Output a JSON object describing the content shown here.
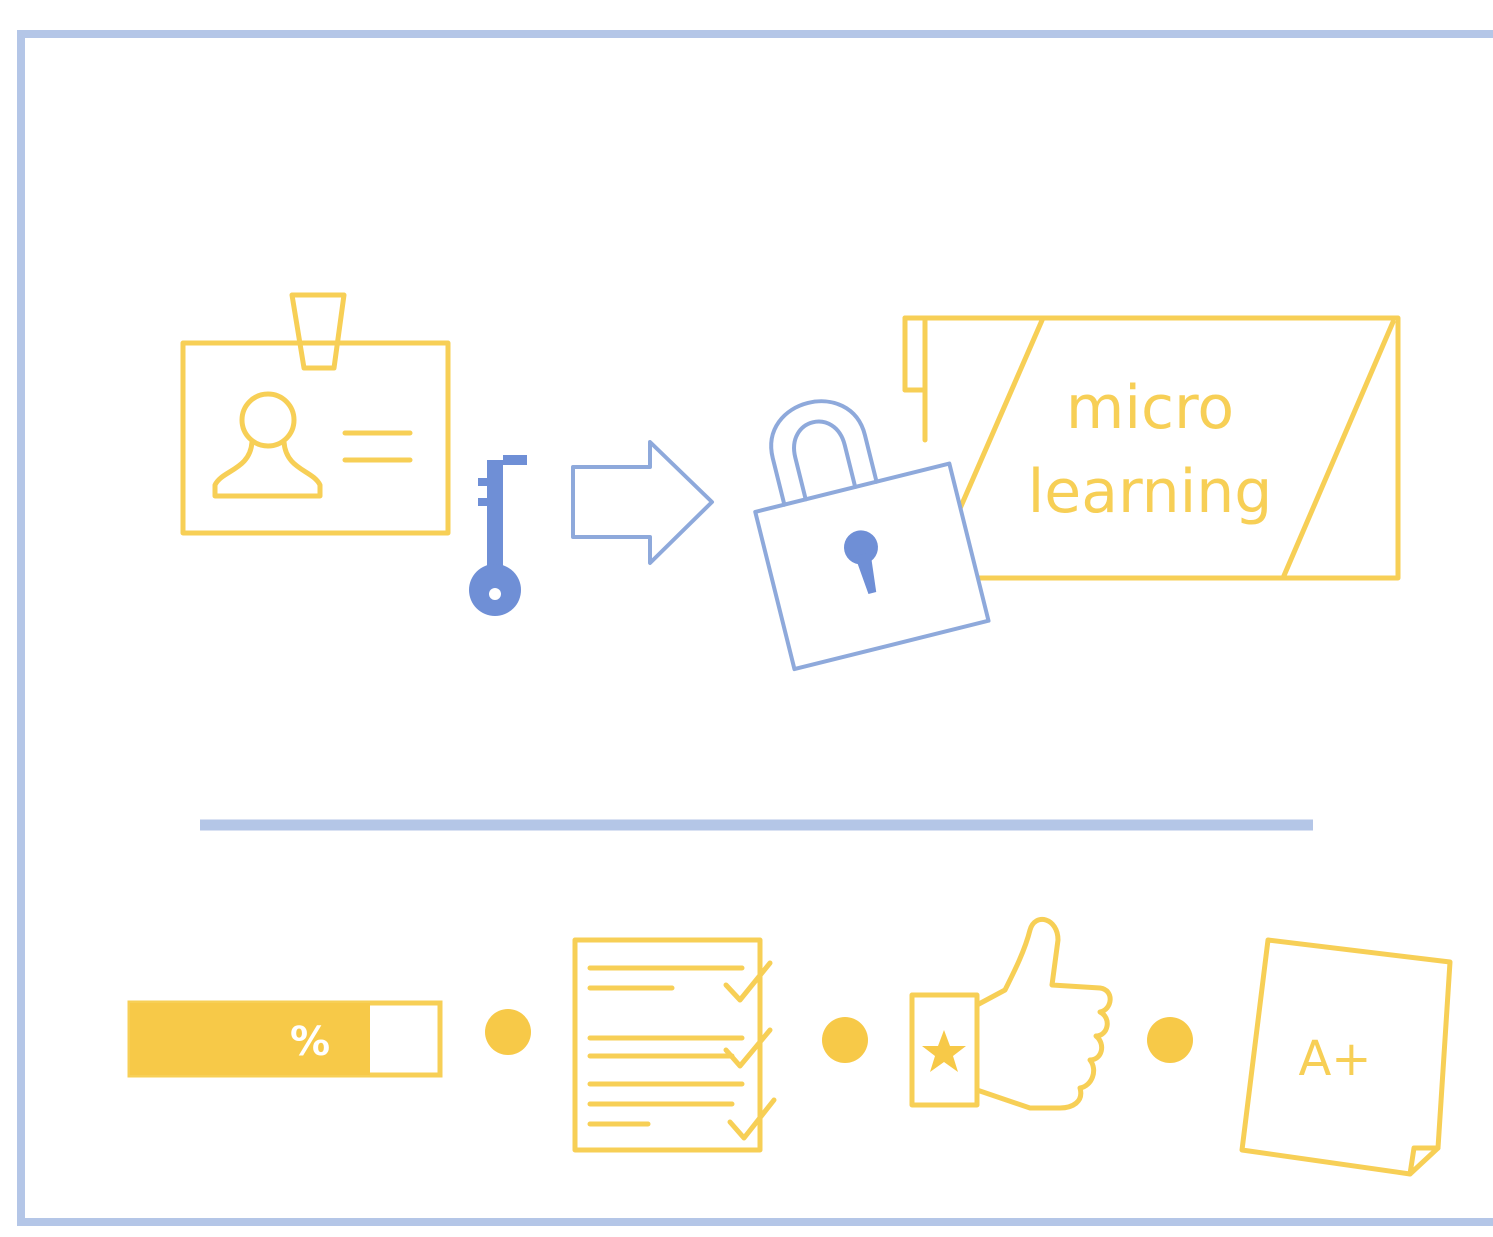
{
  "panel": {
    "microlearning_line1": "micro",
    "microlearning_line2": "learning"
  },
  "progress": {
    "symbol": "%"
  },
  "grade_card": {
    "grade": "A+"
  },
  "colors": {
    "yellow": "#f7cf56",
    "yellow_fill": "#f7c948",
    "blue": "#8ea9db",
    "blue_dark": "#6f8fd6",
    "frame": "#b4c6e7"
  },
  "icons": [
    "id-badge-icon",
    "key-icon",
    "arrow-right-icon",
    "padlock-open-icon",
    "microlearning-panel-icon",
    "progress-bar-icon",
    "checklist-icon",
    "thumbs-up-icon",
    "grade-card-icon"
  ]
}
